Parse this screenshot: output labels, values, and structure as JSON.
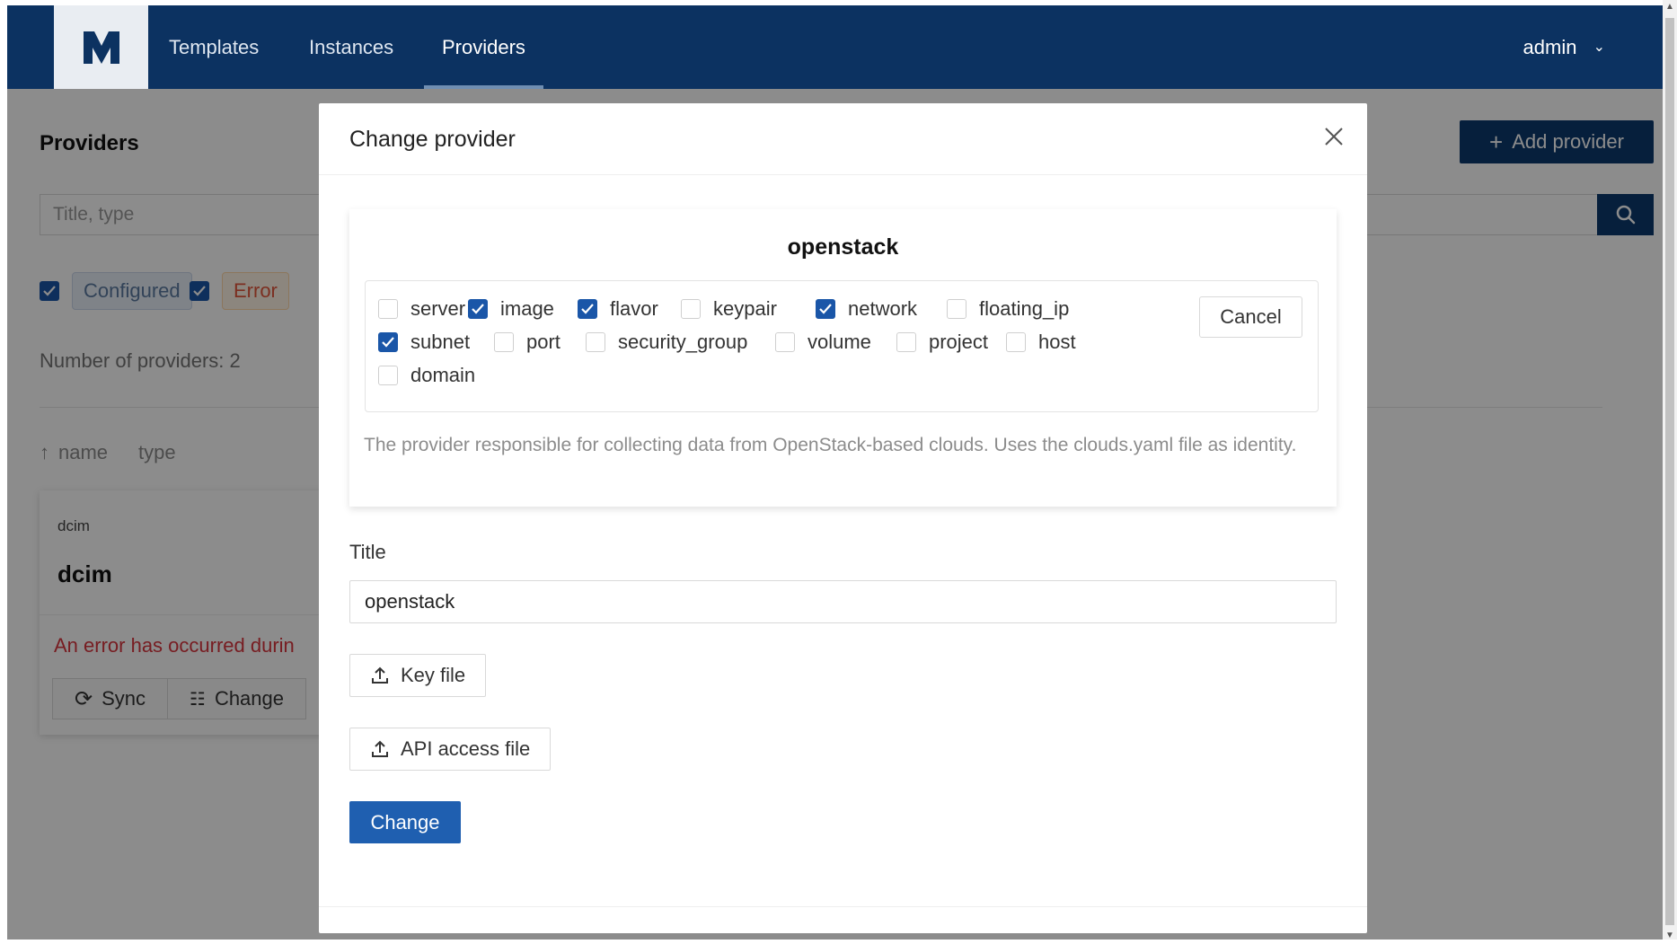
{
  "nav": {
    "items": [
      {
        "label": "Templates"
      },
      {
        "label": "Instances"
      },
      {
        "label": "Providers"
      }
    ],
    "user": "admin",
    "active": "Providers"
  },
  "page": {
    "title": "Providers",
    "add_button": "Add provider",
    "search_placeholder": "Title, type",
    "filters": [
      {
        "label": "Configured",
        "checked": true
      },
      {
        "label": "Error",
        "checked": true
      }
    ],
    "count_text": "Number of providers: 2",
    "sort": {
      "name": "name",
      "type": "type"
    },
    "card": {
      "type": "dcim",
      "title": "dcim",
      "error": "An error has occurred durin",
      "sync_label": "Sync",
      "change_label": "Change"
    }
  },
  "modal": {
    "title": "Change provider",
    "provider_name": "openstack",
    "checkboxes": [
      {
        "label": "server",
        "checked": false
      },
      {
        "label": "image",
        "checked": true
      },
      {
        "label": "flavor",
        "checked": true
      },
      {
        "label": "keypair",
        "checked": false
      },
      {
        "label": "network",
        "checked": true
      },
      {
        "label": "floating_ip",
        "checked": false
      },
      {
        "label": "subnet",
        "checked": true
      },
      {
        "label": "port",
        "checked": false
      },
      {
        "label": "security_group",
        "checked": false
      },
      {
        "label": "volume",
        "checked": false
      },
      {
        "label": "project",
        "checked": false
      },
      {
        "label": "host",
        "checked": false
      },
      {
        "label": "domain",
        "checked": false
      }
    ],
    "cancel_label": "Cancel",
    "description": "The provider responsible for collecting data from OpenStack-based clouds. Uses the clouds.yaml file as identity.",
    "title_label": "Title",
    "title_value": "openstack",
    "key_file_label": "Key file",
    "api_file_label": "API access file",
    "submit_label": "Change"
  },
  "colors": {
    "navbar": "#0c3261",
    "primary": "#1f5fb0",
    "checkbox": "#1a56a8",
    "error": "#d9363e"
  }
}
